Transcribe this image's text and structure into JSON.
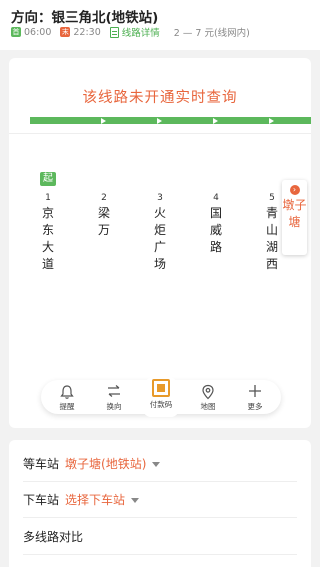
{
  "header": {
    "direction_prefix": "方向：",
    "direction_value": "银三角北(地铁站)",
    "first_bus_tag": "首",
    "first_bus_time": "06:00",
    "last_bus_tag": "末",
    "last_bus_time": "22:30",
    "line_detail_link": "线路详情",
    "fare": "2 — 7 元(线网内)"
  },
  "notice": "该线路未开通实时查询",
  "route": {
    "start_badge": "起",
    "stops": [
      {
        "num": "1",
        "name": "京东大道"
      },
      {
        "num": "2",
        "name": "梁万"
      },
      {
        "num": "3",
        "name": "火炬广场"
      },
      {
        "num": "4",
        "name": "国威路"
      },
      {
        "num": "5",
        "name": "青山湖西"
      }
    ],
    "current_stop": {
      "marker": "›",
      "name": "墩子塘"
    },
    "colors": {
      "line": "#5cb85c",
      "accent": "#e8663d"
    }
  },
  "toolbar": {
    "remind": {
      "icon": "bell-icon",
      "label": "提醒"
    },
    "switch_dir": {
      "icon": "swap-icon",
      "label": "换向"
    },
    "pay": {
      "icon": "qr-code-icon",
      "label": "付款码"
    },
    "map": {
      "icon": "map-pin-icon",
      "label": "地图"
    },
    "more": {
      "icon": "plus-icon",
      "label": "更多"
    }
  },
  "options": {
    "wait_station_label": "等车站",
    "wait_station_value": "墩子塘(地铁站)",
    "alight_station_label": "下车站",
    "alight_station_value": "选择下车站",
    "multi_compare_label": "多线路对比"
  }
}
